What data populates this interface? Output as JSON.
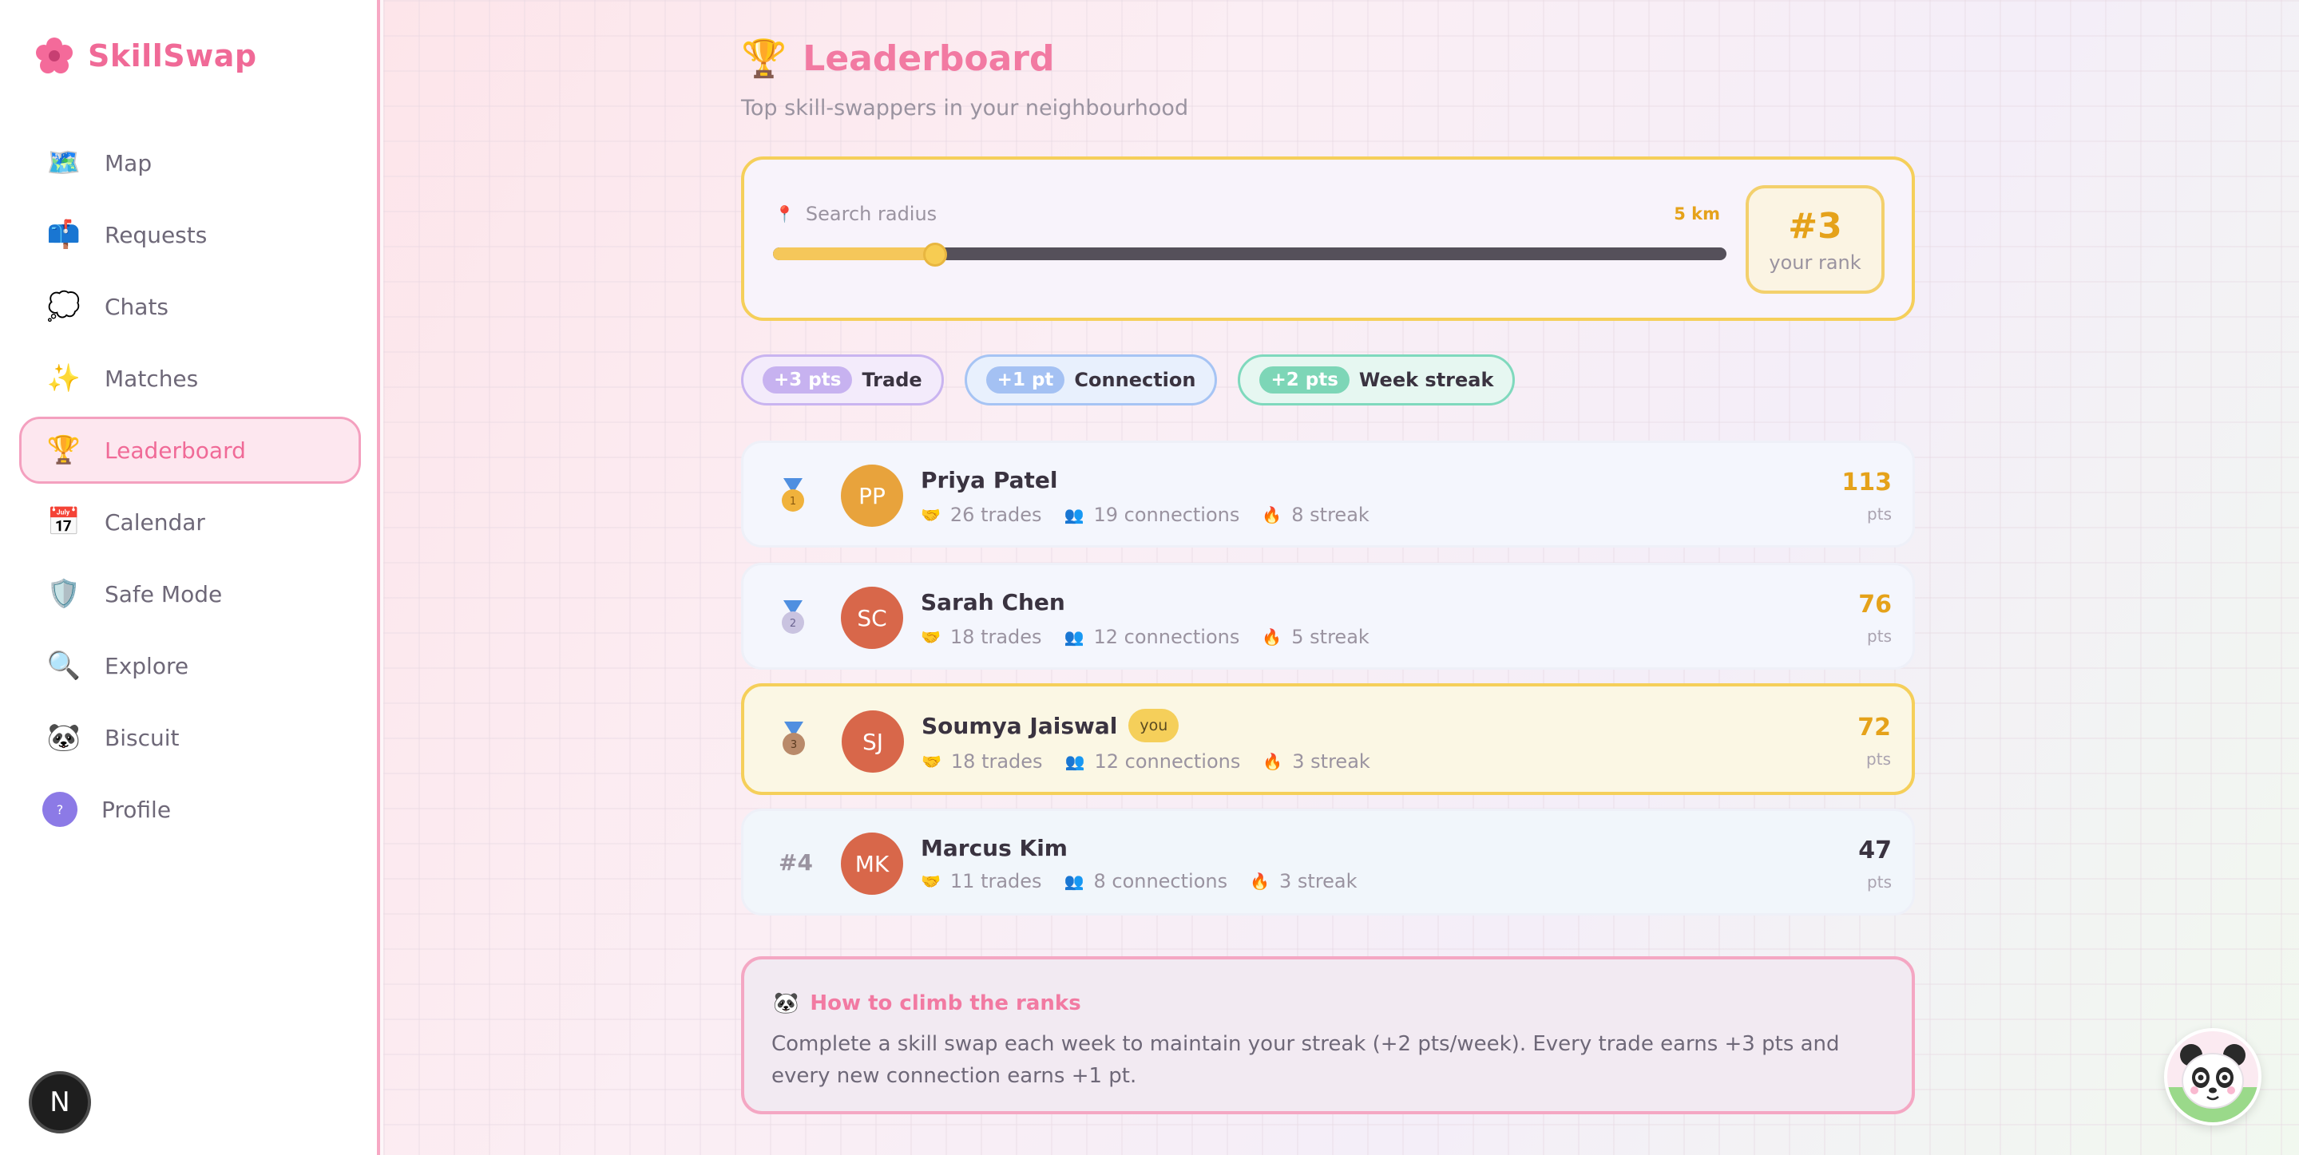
{
  "app": {
    "name": "SkillSwap"
  },
  "sidebar": {
    "items": [
      {
        "label": "Map",
        "icon": "map-icon",
        "glyph": "🗺️"
      },
      {
        "label": "Requests",
        "icon": "mailbox-icon",
        "glyph": "📫"
      },
      {
        "label": "Chats",
        "icon": "speech-bubble-icon",
        "glyph": "💭"
      },
      {
        "label": "Matches",
        "icon": "sparkles-icon",
        "glyph": "✨"
      },
      {
        "label": "Leaderboard",
        "icon": "trophy-icon",
        "glyph": "🏆"
      },
      {
        "label": "Calendar",
        "icon": "calendar-icon",
        "glyph": "📅"
      },
      {
        "label": "Safe Mode",
        "icon": "shield-icon",
        "glyph": "🛡️"
      },
      {
        "label": "Explore",
        "icon": "magnifier-icon",
        "glyph": "🔍"
      },
      {
        "label": "Biscuit",
        "icon": "panda-icon",
        "glyph": "🐼"
      },
      {
        "label": "Profile",
        "icon": "profile-avatar-icon",
        "glyph": "?"
      }
    ],
    "active": "Leaderboard",
    "bottom_badge": "N"
  },
  "header": {
    "title": "Leaderboard",
    "subtitle": "Top skill-swappers in your neighbourhood"
  },
  "radius": {
    "label": "Search radius",
    "value_text": "5 km",
    "slider_fraction": 0.17
  },
  "my_rank": {
    "value": "#3",
    "label": "your rank"
  },
  "point_chips": [
    {
      "pts": "+3 pts",
      "label": "Trade"
    },
    {
      "pts": "+1 pt",
      "label": "Connection"
    },
    {
      "pts": "+2 pts",
      "label": "Week streak"
    }
  ],
  "leaders": [
    {
      "rank": "1",
      "initials": "PP",
      "name": "Priya Patel",
      "trades": "26 trades",
      "connections": "19 connections",
      "streak": "8 streak",
      "points": "113",
      "unit": "pts",
      "avatar_color": "#e8a33c"
    },
    {
      "rank": "2",
      "initials": "SC",
      "name": "Sarah Chen",
      "trades": "18 trades",
      "connections": "12 connections",
      "streak": "5 streak",
      "points": "76",
      "unit": "pts",
      "avatar_color": "#d8674a"
    },
    {
      "rank": "3",
      "initials": "SJ",
      "name": "Soumya Jaiswal",
      "tag": "you",
      "trades": "18 trades",
      "connections": "12 connections",
      "streak": "3 streak",
      "points": "72",
      "unit": "pts",
      "avatar_color": "#d8674a"
    },
    {
      "rank": "#4",
      "initials": "MK",
      "name": "Marcus Kim",
      "trades": "11 trades",
      "connections": "8 connections",
      "streak": "3 streak",
      "points": "47",
      "unit": "pts",
      "avatar_color": "#d8674a"
    }
  ],
  "tip": {
    "title": "How to climb the ranks",
    "body": "Complete a skill swap each week to maintain your streak (+2 pts/week). Every trade earns +3 pts and every new connection earns +1 pt."
  },
  "colors": {
    "accent": "#f06a97",
    "gold": "#e5a21a",
    "highlight_border": "#f5cf5a"
  }
}
